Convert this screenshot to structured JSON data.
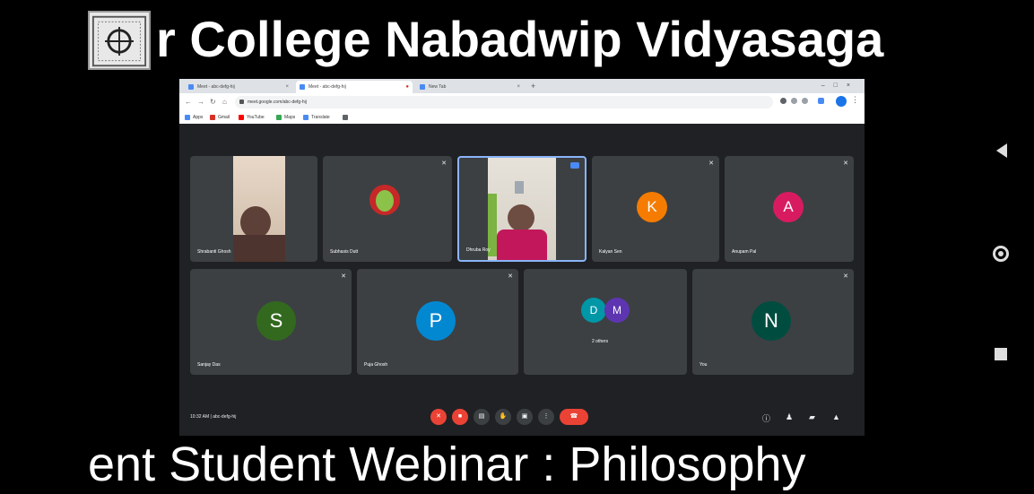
{
  "banner": {
    "top_text": "r College  Nabadwip Vidyasaga",
    "bottom_text": "ent Student Webinar : Philosophy"
  },
  "browser": {
    "tabs": [
      {
        "label": "Meet - abc-defg-hij",
        "active": false
      },
      {
        "label": "Meet - abc-defg-hij",
        "active": true
      },
      {
        "label": "New Tab",
        "active": false
      }
    ],
    "url": "meet.google.com/abc-defg-hij",
    "bookmarks": [
      "Apps",
      "Gmail",
      "YouTube",
      "Maps",
      "Translate"
    ]
  },
  "meeting": {
    "tiles_row1": [
      {
        "name": "Shrabanti Ghosh",
        "type": "video",
        "muted": false
      },
      {
        "name": "Subhasis Dutt",
        "type": "photo",
        "muted": true
      },
      {
        "name": "Dhruba Roy",
        "type": "video",
        "muted": false,
        "pinned": true
      },
      {
        "name": "Kalyan Sen",
        "type": "avatar",
        "initial": "K",
        "color": "#f57c00",
        "muted": true
      },
      {
        "name": "Anupam Pal",
        "type": "avatar",
        "initial": "A",
        "color": "#d81b60",
        "muted": true
      }
    ],
    "tiles_row2": [
      {
        "name": "Sanjay Das",
        "type": "avatar",
        "initial": "S",
        "color": "#33691e",
        "muted": true
      },
      {
        "name": "Puja Ghosh",
        "type": "avatar",
        "initial": "P",
        "color": "#0288d1",
        "muted": true
      },
      {
        "name": "2 others",
        "type": "group",
        "initials": [
          "D",
          "M"
        ],
        "colors": [
          "#0097a7",
          "#5e35b1"
        ],
        "muted": true
      },
      {
        "name": "You",
        "type": "avatar",
        "initial": "N",
        "color": "#004d40",
        "muted": true
      }
    ],
    "info": "10:32 AM  |  abc-defg-hij"
  },
  "colors": {
    "background": "#000000",
    "browser_bg": "#202124",
    "tile_bg": "#3c4043",
    "end_call": "#ea4335"
  }
}
